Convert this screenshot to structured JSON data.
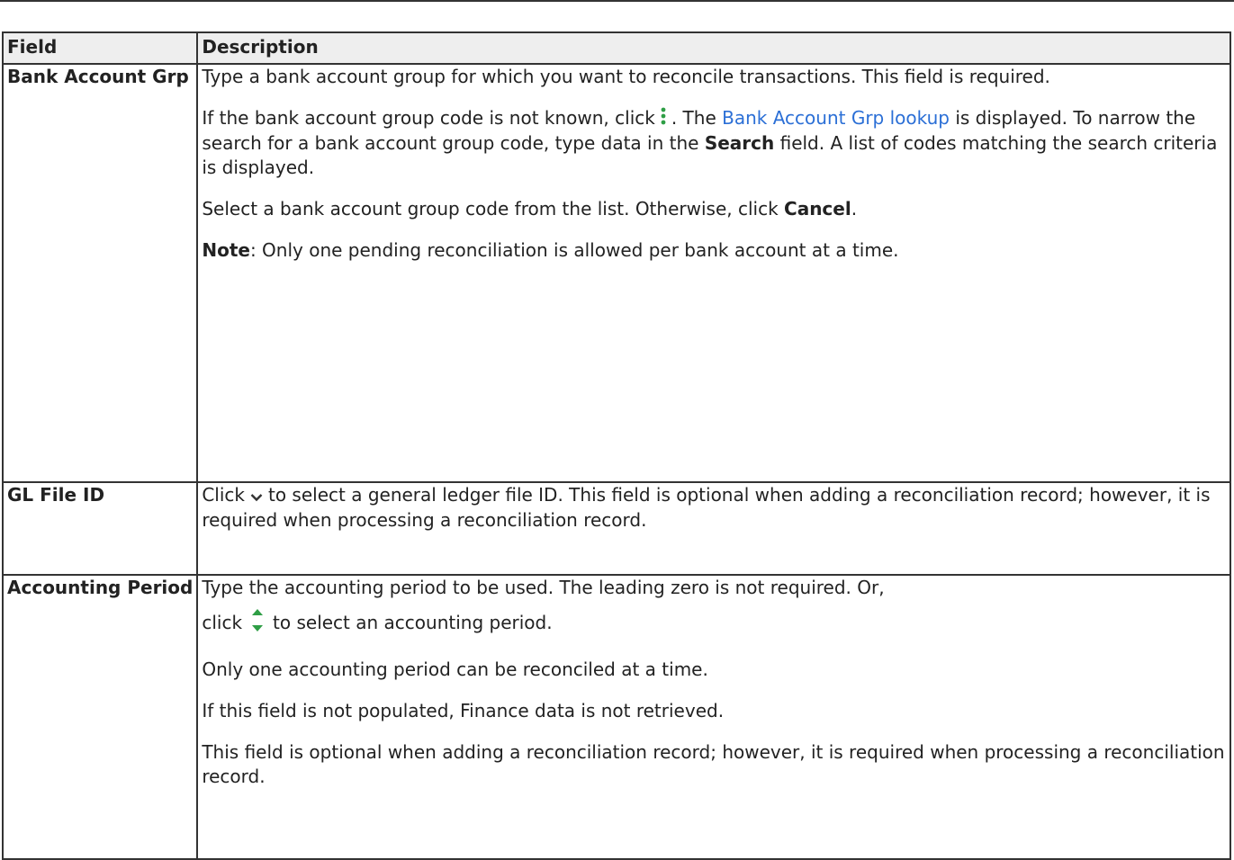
{
  "table": {
    "headers": {
      "field": "Field",
      "description": "Description"
    },
    "rows": [
      {
        "field": "Bank Account Grp",
        "p1": "Type a bank account group for which you want to reconcile transactions. This field is required.",
        "p2_before_icon": "If the bank account group code is not known, click",
        "p2_after_icon": ". The",
        "p2_link": "Bank Account Grp lookup",
        "p2_middle": "is displayed. To narrow the search for a bank account group code, type data in the",
        "p2_bold": "Search",
        "p2_end": "field. A list of codes matching the search criteria is displayed.",
        "p3_start": "Select a bank account group code from the list. Otherwise, click",
        "p3_bold": "Cancel",
        "p3_end": ".",
        "p4_bold": "Note",
        "p4_end": ": Only one pending reconciliation is allowed per bank account at a time.",
        "icon": "vertical-ellipsis-icon"
      },
      {
        "field": "GL File ID",
        "p1_before_icon": "Click",
        "p1_after_icon": "to select a general ledger file ID. This field is optional when adding a reconciliation record; however, it is required when processing a reconciliation record.",
        "icon": "chevron-down-icon"
      },
      {
        "field": "Accounting Period",
        "p1": "Type the accounting period to be used. The leading zero is not required. Or,",
        "p1b_before_icon": "click",
        "p1b_after_icon": "to select an accounting period.",
        "p2": "Only one accounting period can be reconciled at a time.",
        "p3": "If this field is not populated, Finance data is not retrieved.",
        "p4": "This field is optional when adding a reconciliation record; however, it is required when processing a reconciliation record.",
        "icon": "spinner-up-down-icon"
      }
    ]
  },
  "colors": {
    "link": "#2b6fd6",
    "header_bg": "#eeeeee",
    "border": "#333333",
    "icon_green": "#2e9e45"
  }
}
